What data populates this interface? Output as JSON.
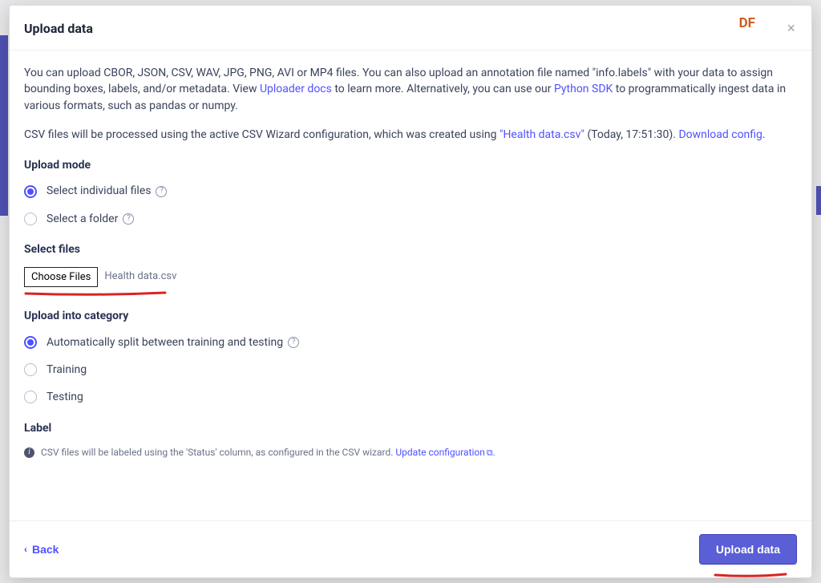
{
  "header": {
    "title": "Upload data",
    "badge": "DF"
  },
  "intro": {
    "p1a": "You can upload CBOR, JSON, CSV, WAV, JPG, PNG, AVI or MP4 files. You can also upload an annotation file named \"info.labels\" with your data to assign bounding boxes, labels, and/or metadata. View ",
    "uploader_docs": "Uploader docs",
    "p1b": " to learn more. Alternatively, you can use our ",
    "python_sdk": "Python SDK",
    "p1c": " to programmatically ingest data in various formats, such as pandas or numpy.",
    "p2a": "CSV files will be processed using the active CSV Wizard configuration, which was created using ",
    "csv_file": "\"Health data.csv\"",
    "p2b": " (Today, 17:51:30). ",
    "download_config": "Download config",
    "period": "."
  },
  "upload_mode": {
    "title": "Upload mode",
    "opt1": "Select individual files",
    "opt2": "Select a folder"
  },
  "select_files": {
    "title": "Select files",
    "button": "Choose Files",
    "file_name": "Health data.csv"
  },
  "category": {
    "title": "Upload into category",
    "opt1": "Automatically split between training and testing",
    "opt2": "Training",
    "opt3": "Testing"
  },
  "label_sec": {
    "title": "Label",
    "info_a": "CSV files will be labeled using the 'Status' column, as configured in the CSV wizard. ",
    "update": "Update configuration"
  },
  "footer": {
    "back": "Back",
    "upload": "Upload data"
  }
}
